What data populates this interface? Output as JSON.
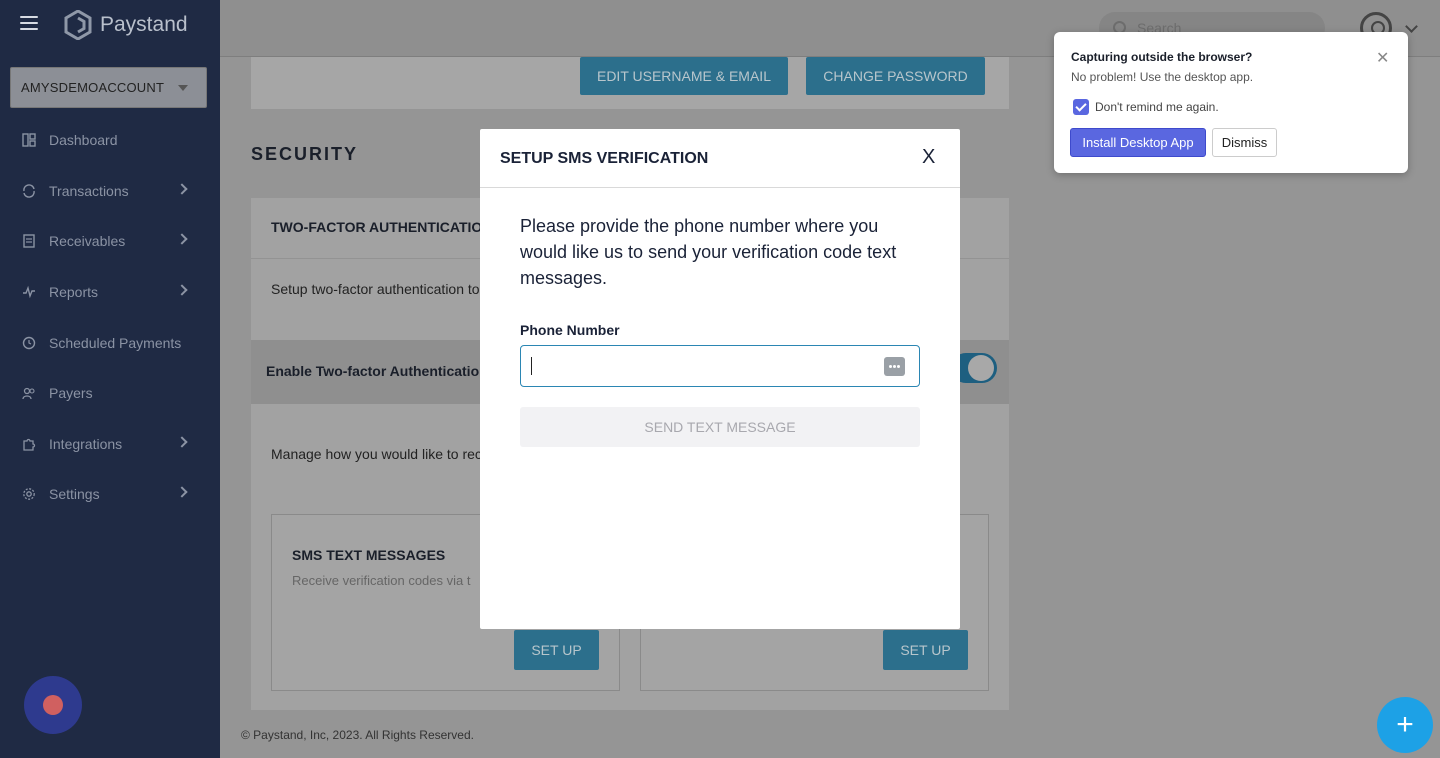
{
  "sidebar": {
    "logo_text": "Paystand",
    "account": "AMYSDEMOACCOUNT",
    "items": [
      {
        "label": "Dashboard",
        "icon": "dashboard-icon",
        "has_chevron": false
      },
      {
        "label": "Transactions",
        "icon": "transactions-icon",
        "has_chevron": true
      },
      {
        "label": "Receivables",
        "icon": "receivables-icon",
        "has_chevron": true
      },
      {
        "label": "Reports",
        "icon": "reports-icon",
        "has_chevron": true
      },
      {
        "label": "Scheduled Payments",
        "icon": "clock-icon",
        "has_chevron": false
      },
      {
        "label": "Payers",
        "icon": "users-icon",
        "has_chevron": false
      },
      {
        "label": "Integrations",
        "icon": "puzzle-icon",
        "has_chevron": true
      },
      {
        "label": "Settings",
        "icon": "gear-icon",
        "has_chevron": true
      }
    ]
  },
  "topbar": {
    "search_placeholder": "Search"
  },
  "account_card": {
    "edit_button": "EDIT USERNAME & EMAIL",
    "password_button": "CHANGE PASSWORD"
  },
  "security": {
    "title": "SECURITY",
    "tfa_heading": "TWO-FACTOR AUTHENTICATIO",
    "tfa_description": "Setup two-factor authentication to",
    "enable_label": "Enable Two-factor Authentication",
    "manage_text": "Manage how you would like to rece",
    "sms_card": {
      "title": "SMS TEXT MESSAGES",
      "description": "Receive verification codes via t",
      "button": "SET UP"
    },
    "other_card": {
      "button": "SET UP"
    }
  },
  "footer": "© Paystand, Inc, 2023. All Rights Reserved.",
  "modal": {
    "title": "SETUP SMS VERIFICATION",
    "close": "X",
    "description": "Please provide the phone number where you would like us to send your verification code text messages.",
    "phone_label": "Phone Number",
    "phone_value": "",
    "send_button": "SEND TEXT MESSAGE"
  },
  "popup": {
    "title": "Capturing outside the browser?",
    "description": "No problem! Use the desktop app.",
    "checkbox_label": "Don't remind me again.",
    "checkbox_checked": true,
    "install_button": "Install Desktop App",
    "dismiss_button": "Dismiss",
    "accent": "#5a67e0"
  },
  "fab_label": "+"
}
